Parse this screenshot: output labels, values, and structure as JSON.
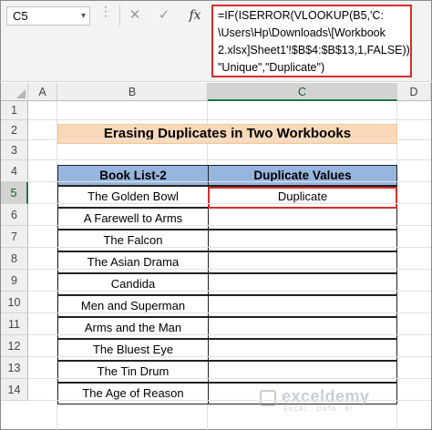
{
  "formula_bar": {
    "name_box": "C5",
    "cancel_icon": "✕",
    "enter_icon": "✓",
    "fx_label": "fx",
    "formula": "=IF(ISERROR(VLOOKUP(B5,'C:\n\\Users\\Hp\\Downloads\\[Workbook\n2.xlsx]Sheet1'!$B$4:$B$13,1,FALSE)),\n\"Unique\",\"Duplicate\")"
  },
  "columns": [
    "A",
    "B",
    "C",
    "D"
  ],
  "active_column": "C",
  "rows": [
    "1",
    "2",
    "3",
    "4",
    "5",
    "6",
    "7",
    "8",
    "9",
    "10",
    "11",
    "12",
    "13",
    "14"
  ],
  "active_row": "5",
  "sheet": {
    "title": "Erasing Duplicates in Two Workbooks",
    "headers": {
      "book_list": "Book List-2",
      "duplicate_values": "Duplicate Values"
    },
    "books": [
      "The Golden Bowl",
      "A Farewell to Arms",
      "The Falcon",
      "The Asian Drama",
      "Candida",
      "Men and Superman",
      "Arms and the Man",
      "The Bluest Eye",
      "The Tin Drum",
      "The Age of Reason"
    ],
    "duplicate_values": [
      "Duplicate",
      "",
      "",
      "",
      "",
      "",
      "",
      "",
      "",
      ""
    ]
  },
  "watermark": {
    "name": "exceldemy",
    "tagline": "EXCEL · DATA · BI"
  },
  "colors": {
    "title_fill": "#fbd9b8",
    "header_fill": "#97b6df",
    "highlight": "#d62d2d",
    "active_header": "#1f7a45"
  }
}
